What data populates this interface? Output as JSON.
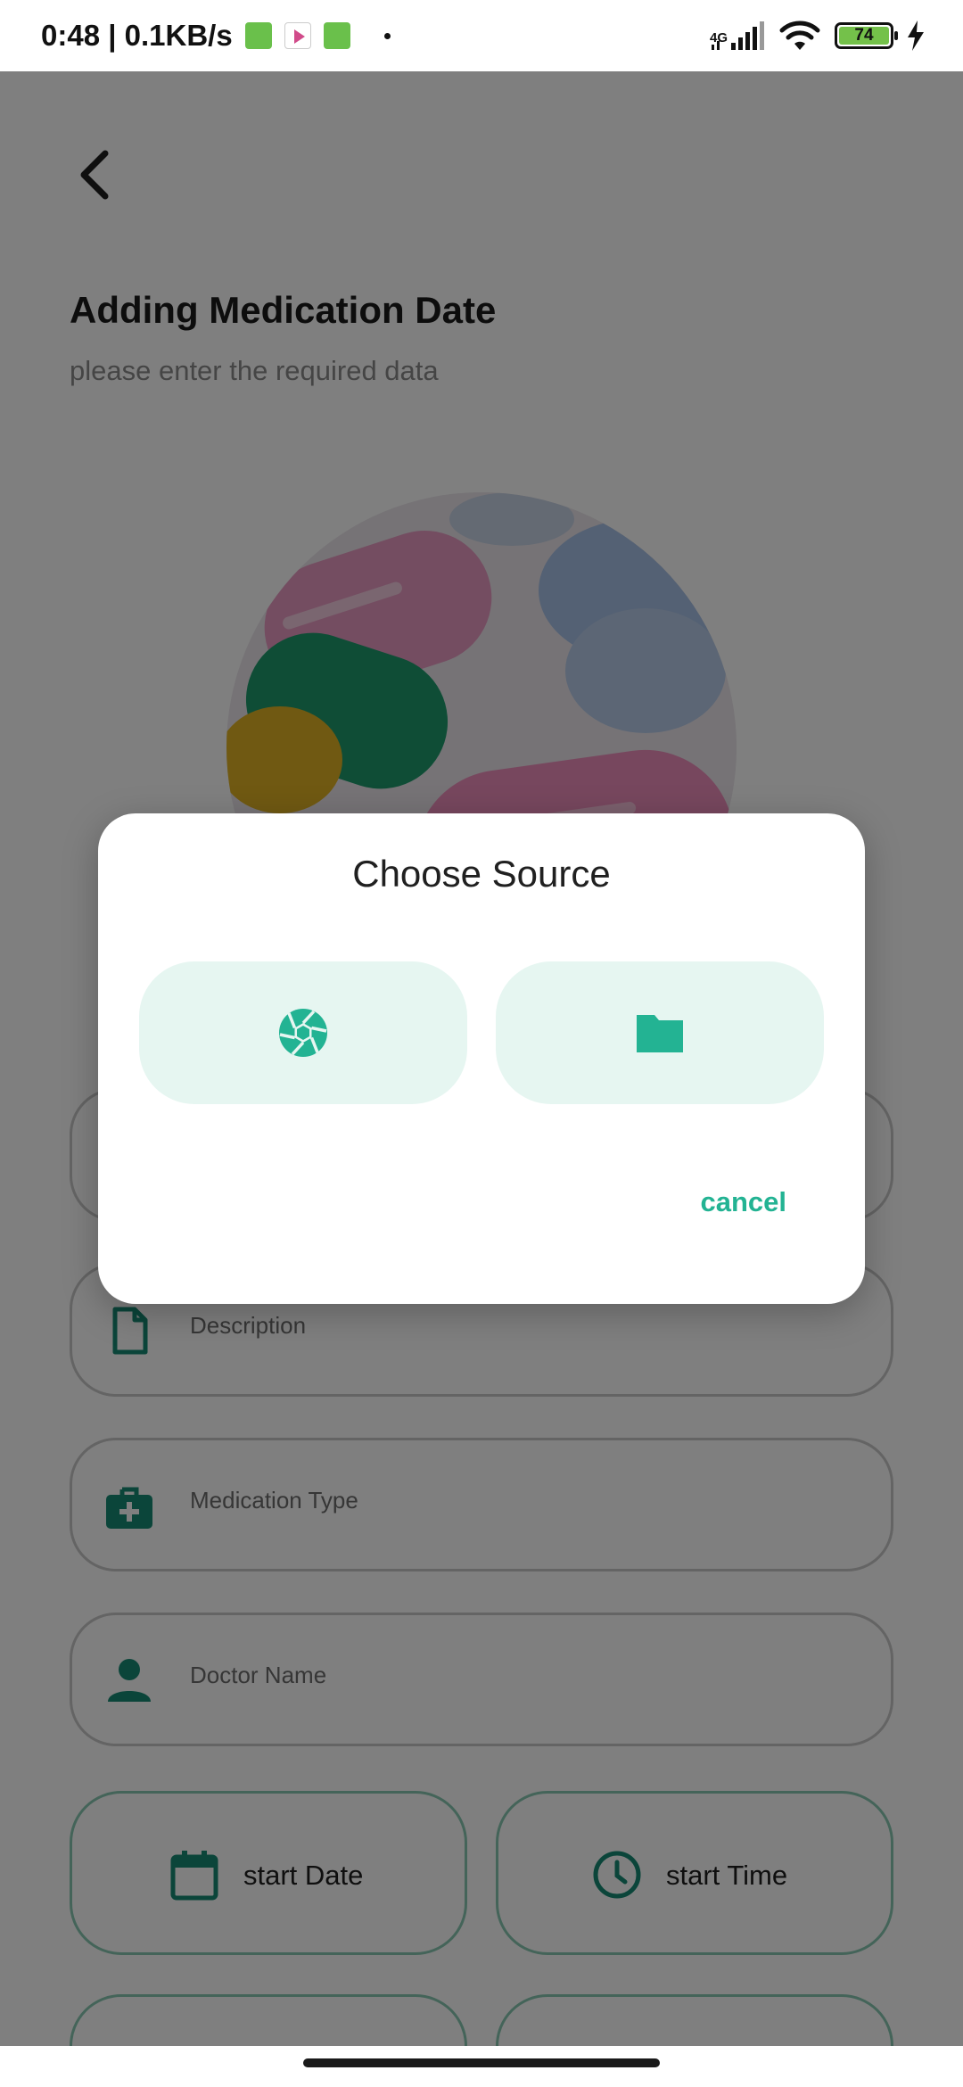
{
  "status_bar": {
    "time_speed": "0:48 | 0.1KB/s",
    "network": "4G",
    "battery_level": "74"
  },
  "page": {
    "title": "Adding Medication Date",
    "subtitle": "please enter the required data",
    "fields": {
      "description": "Description",
      "medication_type": "Medication Type",
      "doctor_name": "Doctor Name"
    },
    "start_date": "start Date",
    "start_time": "start Time"
  },
  "dialog": {
    "title": "Choose Source",
    "camera_icon": "camera-shutter-icon",
    "gallery_icon": "folder-icon",
    "cancel_label": "cancel"
  },
  "colors": {
    "accent": "#23b393",
    "icon_teal": "#168a74",
    "source_button_bg": "#e6f6f1"
  }
}
